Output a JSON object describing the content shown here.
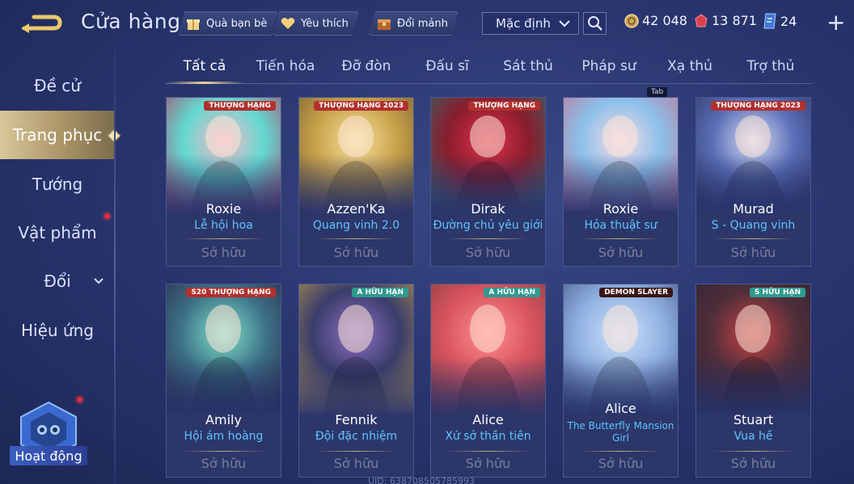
{
  "header": {
    "title": "Cửa hàng",
    "buttons": [
      {
        "label": "Quà bạn bè",
        "icon": "gift-icon"
      },
      {
        "label": "Yêu thích",
        "icon": "heart-icon"
      },
      {
        "label": "Đổi mảnh",
        "icon": "exchange-chest-icon"
      }
    ],
    "sort_value": "Mặc định",
    "currencies": [
      {
        "value": "42 048",
        "icon": "gold-coin-icon",
        "color": "#c9a55a"
      },
      {
        "value": "13 871",
        "icon": "red-gem-icon",
        "color": "#d8424f"
      },
      {
        "value": "24",
        "icon": "voucher-icon",
        "color": "#7fb6ff"
      }
    ]
  },
  "nav": {
    "items": [
      {
        "label": "Đề cử",
        "active": false,
        "notify": false
      },
      {
        "label": "Trang phục",
        "active": true,
        "notify": false
      },
      {
        "label": "Tướng",
        "active": false,
        "notify": true
      },
      {
        "label": "Vật phẩm",
        "active": false,
        "notify": false
      },
      {
        "label": "Đổi",
        "active": false,
        "notify": false,
        "expandable": true
      },
      {
        "label": "Hiệu ứng",
        "active": false,
        "notify": false
      }
    ],
    "event_label": "Hoạt động"
  },
  "tabs": [
    "Tất cả",
    "Tiến hóa",
    "Đỡ đòn",
    "Đấu sĩ",
    "Sát thủ",
    "Pháp sư",
    "Xạ thủ",
    "Trợ thủ"
  ],
  "tooltip": "Tab",
  "cards_row1": [
    {
      "hero": "Roxie",
      "skin": "Lễ hội hoa",
      "status": "Sở hữu",
      "badge": "THƯỢNG HẠNG",
      "colors": [
        "#f7b8c7",
        "#63d9d0",
        "#b03a62"
      ]
    },
    {
      "hero": "Azzen'Ka",
      "skin": "Quang vinh 2.0",
      "status": "Sở hữu",
      "badge": "THƯỢNG HẠNG 2023",
      "colors": [
        "#f4e2a0",
        "#c9a24a",
        "#6b5a2e"
      ]
    },
    {
      "hero": "Dirak",
      "skin": "Đường chủ yêu giới",
      "status": "Sở hữu",
      "badge": "THƯỢNG HẠNG",
      "colors": [
        "#e0314a",
        "#8a1d2d",
        "#2d6a6a"
      ]
    },
    {
      "hero": "Roxie",
      "skin": "Hỏa thuật sư",
      "status": "Sở hữu",
      "badge": "",
      "colors": [
        "#f6dbe8",
        "#8cc0ea",
        "#c46d8c"
      ]
    },
    {
      "hero": "Murad",
      "skin": "S - Quang vinh",
      "status": "Sở hữu",
      "badge": "THƯỢNG HẠNG 2023",
      "colors": [
        "#d7dcf3",
        "#5a6fb8",
        "#2b2f5a"
      ]
    }
  ],
  "cards_row2": [
    {
      "hero": "Amily",
      "skin": "Hội ám hoàng",
      "status": "Sở hữu",
      "badge": "S20 THƯỢNG HẠNG",
      "colors": [
        "#7ee0c8",
        "#3b6f86",
        "#2a1f3a"
      ]
    },
    {
      "hero": "Fennik",
      "skin": "Đội đặc nhiệm",
      "status": "Sở hữu",
      "badge": "A HỮU HẠN",
      "colors": [
        "#8f6fc6",
        "#3a3d6a",
        "#c8a04a"
      ]
    },
    {
      "hero": "Alice",
      "skin": "Xứ sở thần tiên",
      "status": "Sở hữu",
      "badge": "A HỮU HẠN",
      "colors": [
        "#ff8f8f",
        "#d8545f",
        "#7d3a3a"
      ]
    },
    {
      "hero": "Alice",
      "skin": "The Butterfly Mansion Girl",
      "status": "Sở hữu",
      "badge": "DEMON SLAYER",
      "colors": [
        "#cfe3ff",
        "#8fb0e0",
        "#3b4a7a"
      ]
    },
    {
      "hero": "Stuart",
      "skin": "Vua hề",
      "status": "Sở hữu",
      "badge": "S HỮU HẠN",
      "colors": [
        "#c94343",
        "#4f2e3a",
        "#2a2233"
      ]
    }
  ],
  "footer_uid": "UID: 638708505785993"
}
